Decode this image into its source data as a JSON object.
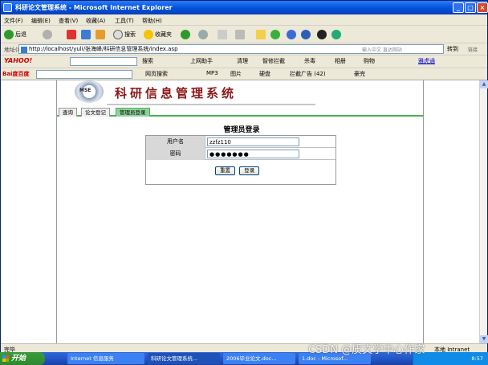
{
  "window": {
    "title": "科研论文管理系统 - Microsoft Internet Explorer"
  },
  "menu": [
    "文件(F)",
    "编辑(E)",
    "查看(V)",
    "收藏(A)",
    "工具(T)",
    "帮助(H)"
  ],
  "toolbar": {
    "back": "后退",
    "search": "搜索",
    "favorites": "收藏夹"
  },
  "address": {
    "label": "地址(D)",
    "url": "http://localhost/yuli/张海峰/科研信息管理系统/index.asp",
    "hint": "输入中文 直达网站",
    "go": "转到",
    "links": "链接"
  },
  "yahoo": {
    "logo": "YAHOO!",
    "search": "搜索",
    "helper": "上网助手",
    "clear": "清理",
    "popup": "智修拦截",
    "kill": "杀毒",
    "photo": "相册",
    "shop": "购物",
    "dating": "雅虎通"
  },
  "baidu": {
    "logo": "Bai度百度",
    "websearch": "网页搜索",
    "mp3": "MP3",
    "image": "图片",
    "disk": "硬盘",
    "adblock": "拦截广告 (42)",
    "blog": "豪完"
  },
  "site": {
    "logo": "MSE",
    "title": "科研信息管理系统"
  },
  "tabs": [
    "查询",
    "论文登记",
    "管理员登录"
  ],
  "form": {
    "title": "管理员登录",
    "user_label": "用户名",
    "user_value": "zzfz110",
    "pwd_label": "密码",
    "pwd_value": "●●●●●●●",
    "reset": "重置",
    "submit": "登录"
  },
  "status": {
    "text": "完毕",
    "zone": "本地 Intranet"
  },
  "taskbar": {
    "start": "开始",
    "tasks": [
      "Internet 信息服务",
      "科研论文管理系统...",
      "2006毕业论文.doc...",
      "1.doc - Microsof..."
    ],
    "time": "8:57"
  },
  "watermark": "CSDN @质文学中心作家"
}
